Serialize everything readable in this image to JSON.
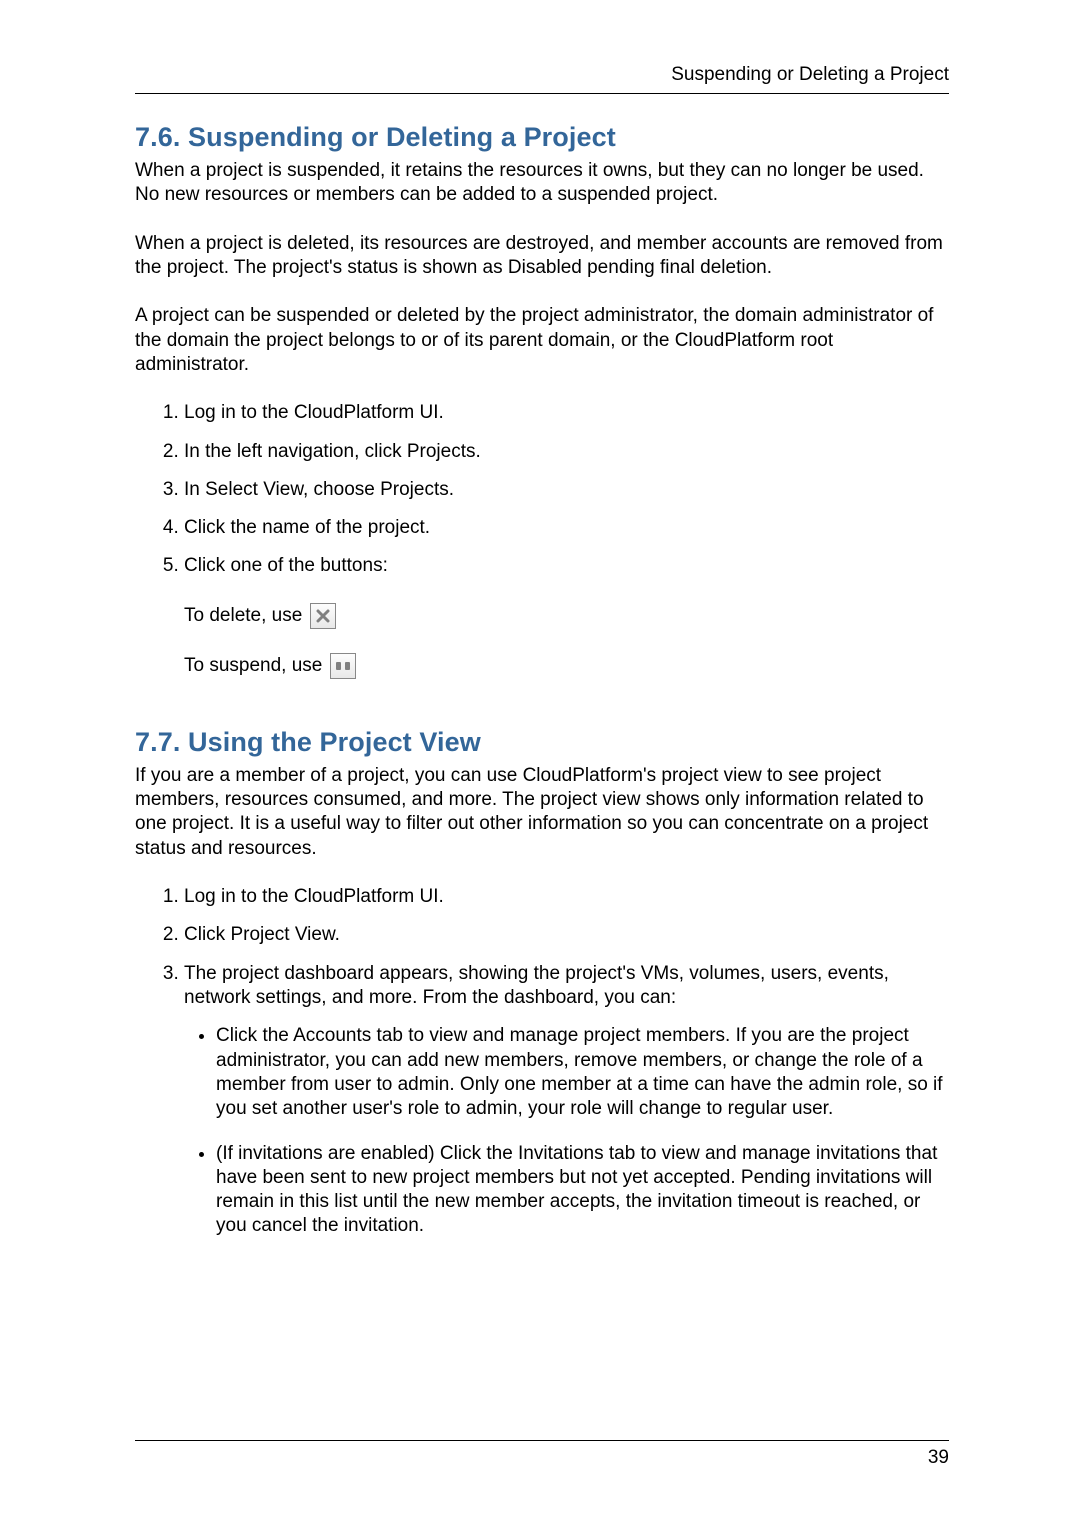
{
  "header": {
    "running_title": "Suspending or Deleting a Project"
  },
  "section76": {
    "heading": "7.6. Suspending or Deleting a Project",
    "para1": "When a project is suspended, it retains the resources it owns, but they can no longer be used. No new resources or members can be added to a suspended project.",
    "para2": "When a project is deleted, its resources are destroyed, and member accounts are removed from the project. The project's status is shown as Disabled pending final deletion.",
    "para3": "A project can be suspended or deleted by the project administrator, the domain administrator of the domain the project belongs to or of its parent domain, or the CloudPlatform root administrator.",
    "steps": [
      "Log in to the CloudPlatform UI.",
      "In the left navigation, click Projects.",
      "In Select View, choose Projects.",
      "Click the name of the project.",
      "Click one of the buttons:"
    ],
    "delete_lead": "To delete, use",
    "suspend_lead": "To suspend, use"
  },
  "section77": {
    "heading": "7.7. Using the Project View",
    "para1": "If you are a member of a project, you can use CloudPlatform's project view to see project members, resources consumed, and more. The project view shows only information related to one project. It is a useful way to filter out other information so you can concentrate on a project status and resources.",
    "steps": [
      "Log in to the CloudPlatform UI.",
      "Click Project View.",
      "The project dashboard appears, showing the project's VMs, volumes, users, events, network settings, and more. From the dashboard, you can:"
    ],
    "bullets": [
      "Click the Accounts tab to view and manage project members. If you are the project administrator, you can add new members, remove members, or change the role of a member from user to admin. Only one member at a time can have the admin role, so if you set another user's role to admin, your role will change to regular user.",
      "(If invitations are enabled) Click the Invitations tab to view and manage invitations that have been sent to new project members but not yet accepted. Pending invitations will remain in this list until the new member accepts, the invitation timeout is reached, or you cancel the invitation."
    ]
  },
  "footer": {
    "page_number": "39"
  }
}
